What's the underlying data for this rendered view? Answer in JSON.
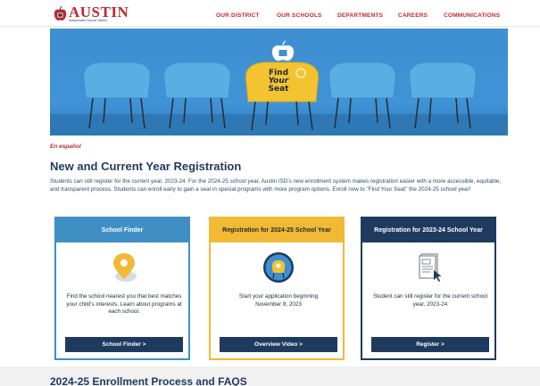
{
  "header": {
    "logo_text": "AUSTIN",
    "logo_subtext": "Independent School District",
    "nav": [
      {
        "label": "OUR DISTRICT"
      },
      {
        "label": "OUR SCHOOLS"
      },
      {
        "label": "DEPARTMENTS"
      },
      {
        "label": "CAREERS"
      },
      {
        "label": "COMMUNICATIONS"
      }
    ]
  },
  "hero": {
    "line1": "Find",
    "line2": "Your",
    "line3": "Seat"
  },
  "main": {
    "espanol_link": "En español",
    "title": "New and Current Year Registration",
    "intro": "Students can still register for the current year, 2023-24. For the 2024-25 school year, Austin ISD's new enrollment system makes registration easier with a more accessible, equitable, and transparent process. Students can enroll early to gain a seat in special programs with more program options. Enroll now to \"Find Your Seat\" the 2024-25 school year!"
  },
  "cards": [
    {
      "heading": "School Finder",
      "icon": "map-pin-icon",
      "text": "Find the school nearest you that best matches your child's interests. Learn about programs at each school.",
      "button": "School Finder >"
    },
    {
      "heading": "Registration for 2024-25 School Year",
      "icon": "chair-badge-icon",
      "text": "Start your application beginning November 8, 2023",
      "button": "Overview Video >"
    },
    {
      "heading": "Registration for 2023-24 School Year",
      "icon": "document-cursor-icon",
      "text": "Student can still register for the current school year, 2023-24",
      "button": "Register >"
    }
  ],
  "section2": {
    "title": "2024-25 Enrollment Process and FAQS"
  },
  "colors": {
    "brand_red": "#c1272d",
    "navy": "#1f3a5f",
    "sky": "#3f8fc4",
    "gold": "#f2b934"
  }
}
